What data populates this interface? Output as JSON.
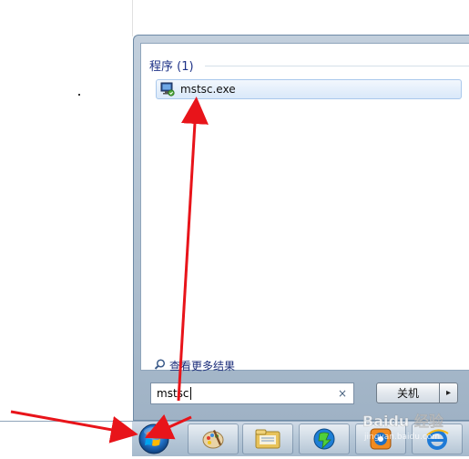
{
  "start_menu": {
    "section_header": "程序 (1)",
    "results": [
      {
        "label": "mstsc.exe",
        "icon": "remote-desktop-icon"
      }
    ],
    "see_more_label": "查看更多结果",
    "search": {
      "value": "mstsc",
      "clear_icon": "×"
    },
    "shutdown": {
      "label": "关机",
      "arrow": "▸"
    }
  },
  "taskbar": {
    "items": [
      {
        "name": "paint-icon"
      },
      {
        "name": "file-explorer-icon"
      },
      {
        "name": "download-icon"
      },
      {
        "name": "media-app-icon"
      },
      {
        "name": "internet-explorer-icon"
      }
    ]
  },
  "watermark": {
    "text": "Baidu 经验",
    "sub": "jingyan.baidu.com"
  },
  "colors": {
    "accent": "#1e3287",
    "arrow": "#e8141a"
  }
}
